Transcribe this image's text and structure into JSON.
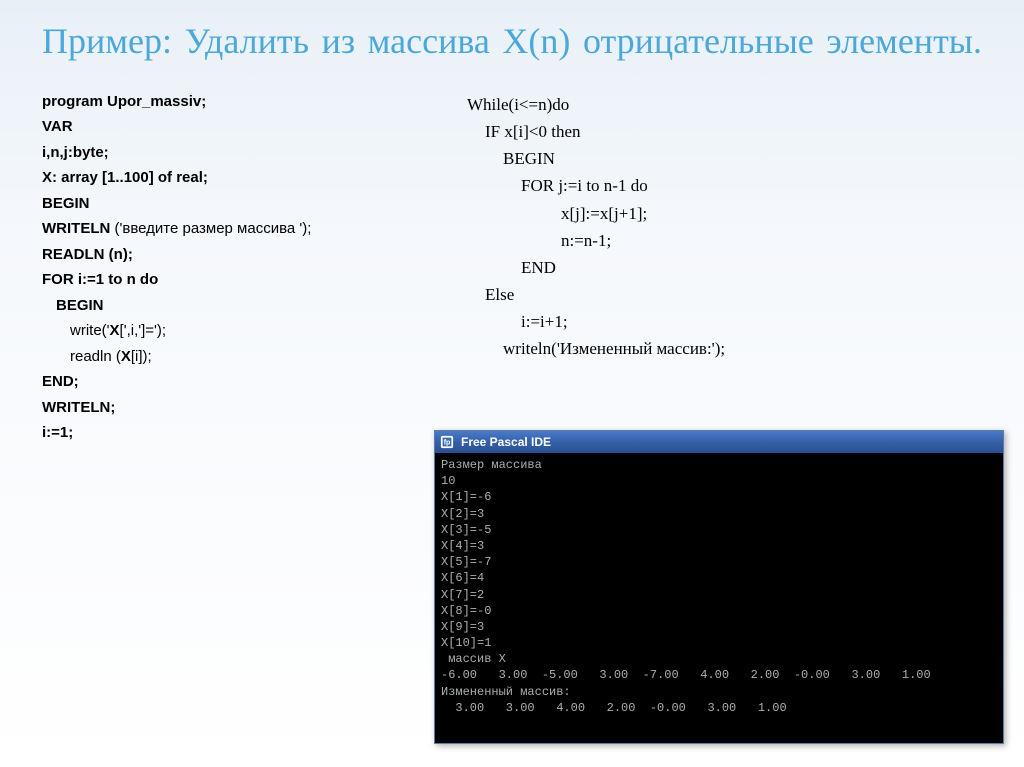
{
  "title": "Пример: Удалить из массива X(n) отрицательные элементы.",
  "left": {
    "l1": "program Upor_massiv;",
    "l2": "VAR",
    "l3": "i,n,j:byte;",
    "l4": "X: array [1..100] of real;",
    "l5": "BEGIN",
    "l6a": "WRITELN ",
    "l6b": "('введите размер массива ');",
    "l7": "READLN (n);",
    "l8": "FOR i:=1 to n do",
    "l9": "BEGIN",
    "l10a": "write('",
    "l10b": "X",
    "l10c": "[',i,']=');",
    "l11a": "readln (",
    "l11b": "X",
    "l11c": "[i]);",
    "l12": "END;",
    "l13": "WRITELN;",
    "l14": "i:=1;"
  },
  "right": {
    "r1": "While(i<=n)do",
    "r2": "IF x[i]<0 then",
    "r3": "BEGIN",
    "r4": "FOR j:=i to n-1 do",
    "r5": "x[j]:=x[j+1];",
    "r6": "n:=n-1;",
    "r7": "END",
    "r8": "Else",
    "r9": "i:=i+1;",
    "r10": "writeln('Измененный массив:');"
  },
  "window": {
    "title": "Free Pascal IDE"
  },
  "console": {
    "c1": "Размер массива",
    "c2": "10",
    "c3": "X[1]=-6",
    "c4": "X[2]=3",
    "c5": "X[3]=-5",
    "c6": "X[4]=3",
    "c7": "X[5]=-7",
    "c8": "X[6]=4",
    "c9": "X[7]=2",
    "c10": "X[8]=-0",
    "c11": "X[9]=3",
    "c12": "X[10]=1",
    "c13": " массив X",
    "c14": "-6.00   3.00  -5.00   3.00  -7.00   4.00   2.00  -0.00   3.00   1.00",
    "c15": "Измененный массив:",
    "c16": "  3.00   3.00   4.00   2.00  -0.00   3.00   1.00"
  }
}
